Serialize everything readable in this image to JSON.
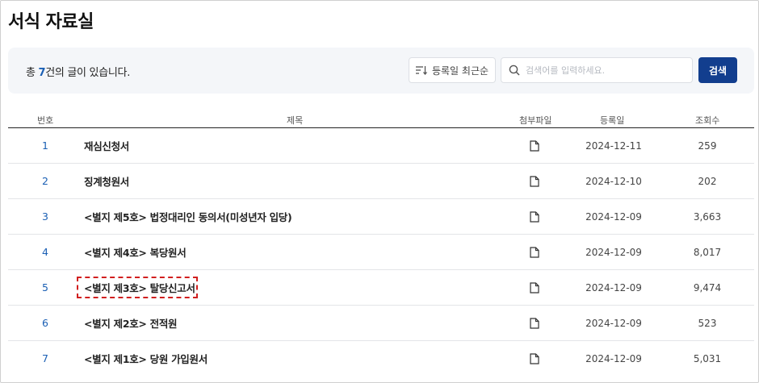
{
  "page": {
    "title": "서식 자료실"
  },
  "toolbar": {
    "count_prefix": "총 ",
    "count_value": "7",
    "count_suffix": "건의 글이 있습니다.",
    "sort_label": "등록일 최근순",
    "search_placeholder": "검색어를 입력하세요.",
    "search_value": "",
    "search_button": "검색"
  },
  "table": {
    "headers": {
      "no": "번호",
      "title": "제목",
      "attachment": "첨부파일",
      "date": "등록일",
      "views": "조회수"
    },
    "rows": [
      {
        "no": "1",
        "title": "재심신청서",
        "date": "2024-12-11",
        "views": "259"
      },
      {
        "no": "2",
        "title": "징계청원서",
        "date": "2024-12-10",
        "views": "202"
      },
      {
        "no": "3",
        "title": "<별지 제5호> 법정대리인 동의서(미성년자 입당)",
        "date": "2024-12-09",
        "views": "3,663"
      },
      {
        "no": "4",
        "title": "<별지 제4호> 복당원서",
        "date": "2024-12-09",
        "views": "8,017"
      },
      {
        "no": "5",
        "title": "<별지 제3호> 탈당신고서",
        "date": "2024-12-09",
        "views": "9,474"
      },
      {
        "no": "6",
        "title": "<별지 제2호> 전적원",
        "date": "2024-12-09",
        "views": "523"
      },
      {
        "no": "7",
        "title": "<별지 제1호> 당원 가입원서",
        "date": "2024-12-09",
        "views": "5,031"
      }
    ]
  },
  "icons": {
    "sort": "sort-lines-icon",
    "search": "magnifier-icon",
    "attachment": "document-icon"
  },
  "colors": {
    "accent_blue": "#1a5fb4",
    "search_button_bg": "#123e8e",
    "highlight_red": "#d11f1f",
    "toolbar_bg": "#f4f6f9"
  }
}
